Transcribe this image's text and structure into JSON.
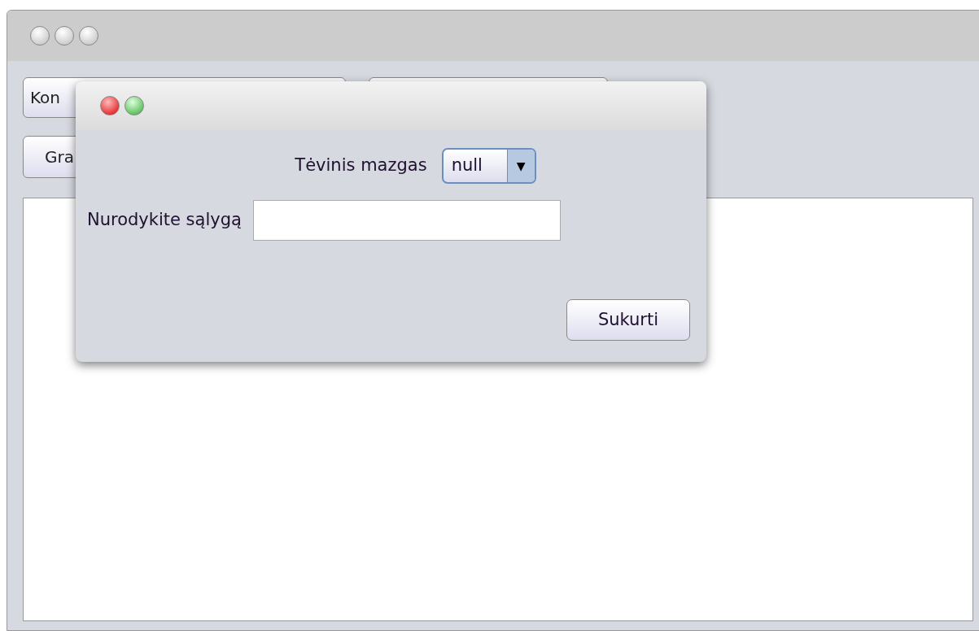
{
  "main_window": {
    "toolbar": {
      "combo": {
        "value": "Kon"
      },
      "button": {
        "label": "Gra"
      }
    }
  },
  "dialog": {
    "parent_node": {
      "label": "Tėvinis mazgas",
      "value": "null",
      "arrow": "▼"
    },
    "condition": {
      "label": "Nurodykite sąlygą"
    },
    "create_button": {
      "label": "Sukurti"
    }
  }
}
